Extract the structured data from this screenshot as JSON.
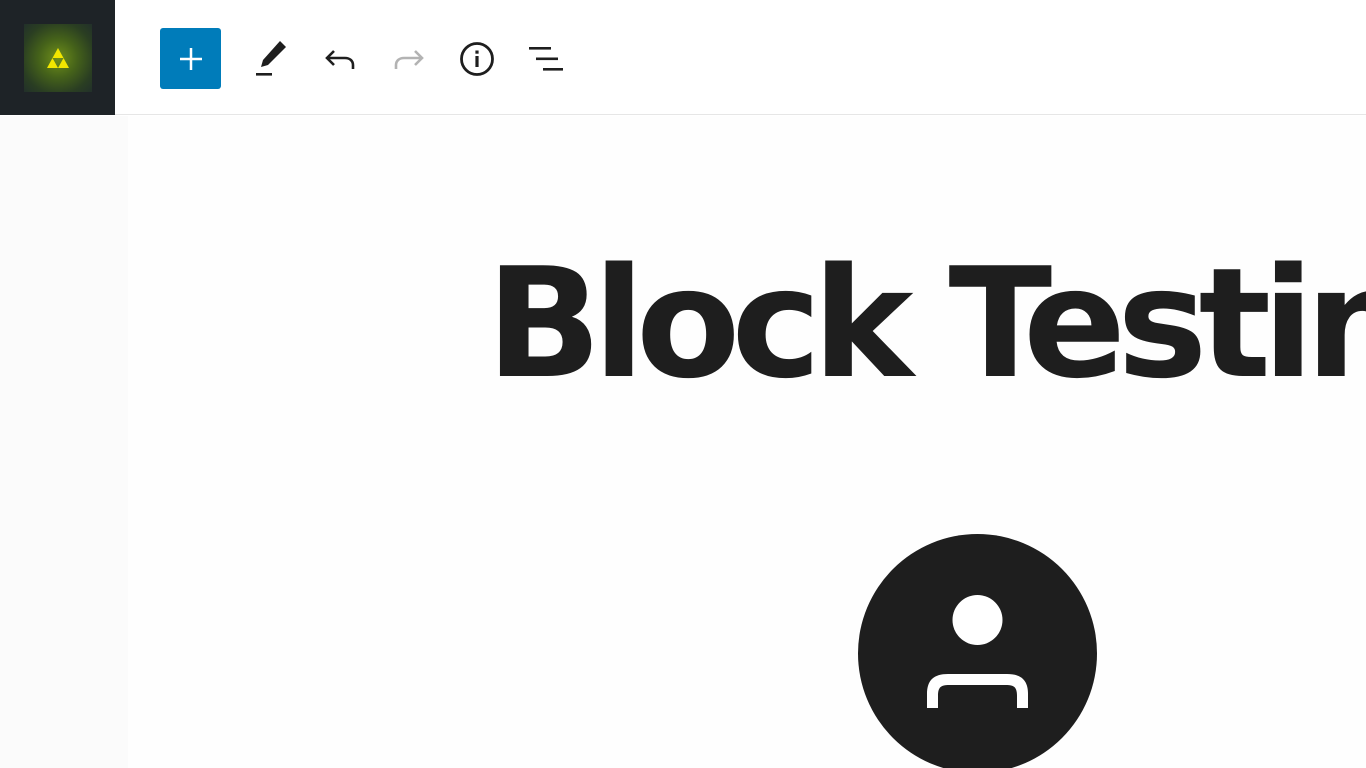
{
  "toolbar": {
    "site_logo_icon": "triforce-logo-icon",
    "inserter_icon": "plus-icon",
    "tools_icon": "pencil-icon",
    "undo_icon": "undo-arrow-icon",
    "redo_icon": "redo-arrow-icon",
    "info_icon": "info-icon",
    "outline_icon": "list-view-icon",
    "accent_color": "#007cba",
    "logo_bg_color": "#1e2327",
    "redo_disabled": true
  },
  "editor": {
    "title": "Block Testing",
    "avatar_icon": "user-avatar-icon",
    "text_color": "#1e1e1e"
  }
}
